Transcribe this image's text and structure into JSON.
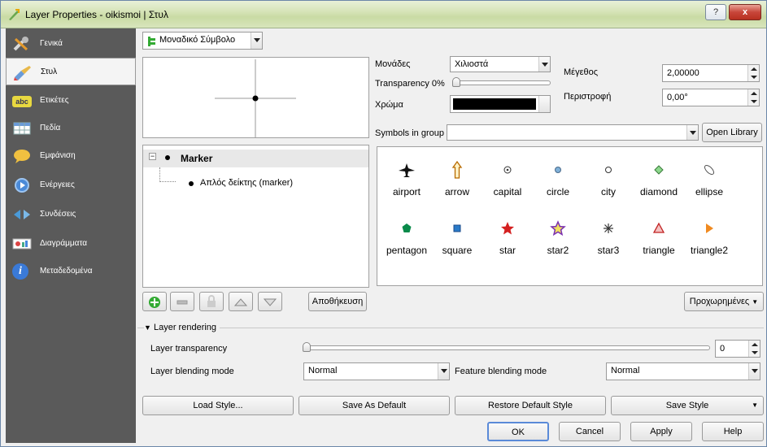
{
  "window": {
    "title": "Layer Properties - oikismoi | Στυλ",
    "help_label": "?",
    "close_label": "x"
  },
  "sidebar": {
    "items": [
      {
        "label": "Γενικά",
        "icon": "wrench-icon"
      },
      {
        "label": "Στυλ",
        "icon": "paintbrush-icon"
      },
      {
        "label": "Ετικέτες",
        "icon": "abc-label-icon",
        "badge": "abc"
      },
      {
        "label": "Πεδία",
        "icon": "table-fields-icon"
      },
      {
        "label": "Εμφάνιση",
        "icon": "speech-bubble-icon"
      },
      {
        "label": "Ενέργειες",
        "icon": "gear-actions-icon"
      },
      {
        "label": "Συνδέσεις",
        "icon": "join-icon"
      },
      {
        "label": "Διαγράμματα",
        "icon": "chart-icon"
      },
      {
        "label": "Μεταδεδομένα",
        "icon": "info-icon",
        "badge": "i"
      }
    ],
    "active_index": 1
  },
  "renderer": {
    "selected": "Μοναδικό Σύμβολο"
  },
  "tree": {
    "root": "Marker",
    "child": "Απλός δείκτης (marker)"
  },
  "props": {
    "units_label": "Μονάδες",
    "units_value": "Χιλιοστά",
    "transparency_label": "Transparency 0%",
    "color_label": "Χρώμα",
    "color_value": "#000000",
    "size_label": "Μέγεθος",
    "size_value": "2,00000",
    "rotation_label": "Περιστροφή",
    "rotation_value": "0,00°"
  },
  "symbols": {
    "group_label": "Symbols in group",
    "group_value": "",
    "open_library_label": "Open Library",
    "items": [
      {
        "name": "airport",
        "icon": "airplane-icon"
      },
      {
        "name": "arrow",
        "icon": "arrow-up-icon"
      },
      {
        "name": "capital",
        "icon": "capital-icon"
      },
      {
        "name": "circle",
        "icon": "circle-icon"
      },
      {
        "name": "city",
        "icon": "city-icon"
      },
      {
        "name": "diamond",
        "icon": "diamond-icon"
      },
      {
        "name": "ellipse",
        "icon": "ellipse-icon"
      },
      {
        "name": "pentagon",
        "icon": "pentagon-icon"
      },
      {
        "name": "square",
        "icon": "square-icon"
      },
      {
        "name": "star",
        "icon": "star-icon"
      },
      {
        "name": "star2",
        "icon": "star2-icon"
      },
      {
        "name": "star3",
        "icon": "asterisk-icon"
      },
      {
        "name": "triangle",
        "icon": "triangle-icon"
      },
      {
        "name": "triangle2",
        "icon": "triangle-right-icon"
      }
    ]
  },
  "toolbar": {
    "save_label": "Αποθήκευση",
    "advanced_label": "Προχωρημένες"
  },
  "rendering": {
    "header": "Layer rendering",
    "transparency_label": "Layer transparency",
    "transparency_value": "0",
    "blending_label": "Layer blending mode",
    "blending_value": "Normal",
    "feature_blending_label": "Feature blending mode",
    "feature_blending_value": "Normal"
  },
  "style_buttons": {
    "load": "Load Style...",
    "save_default": "Save As Default",
    "restore": "Restore Default Style",
    "save": "Save Style"
  },
  "dialog_buttons": {
    "ok": "OK",
    "cancel": "Cancel",
    "apply": "Apply",
    "help": "Help"
  }
}
